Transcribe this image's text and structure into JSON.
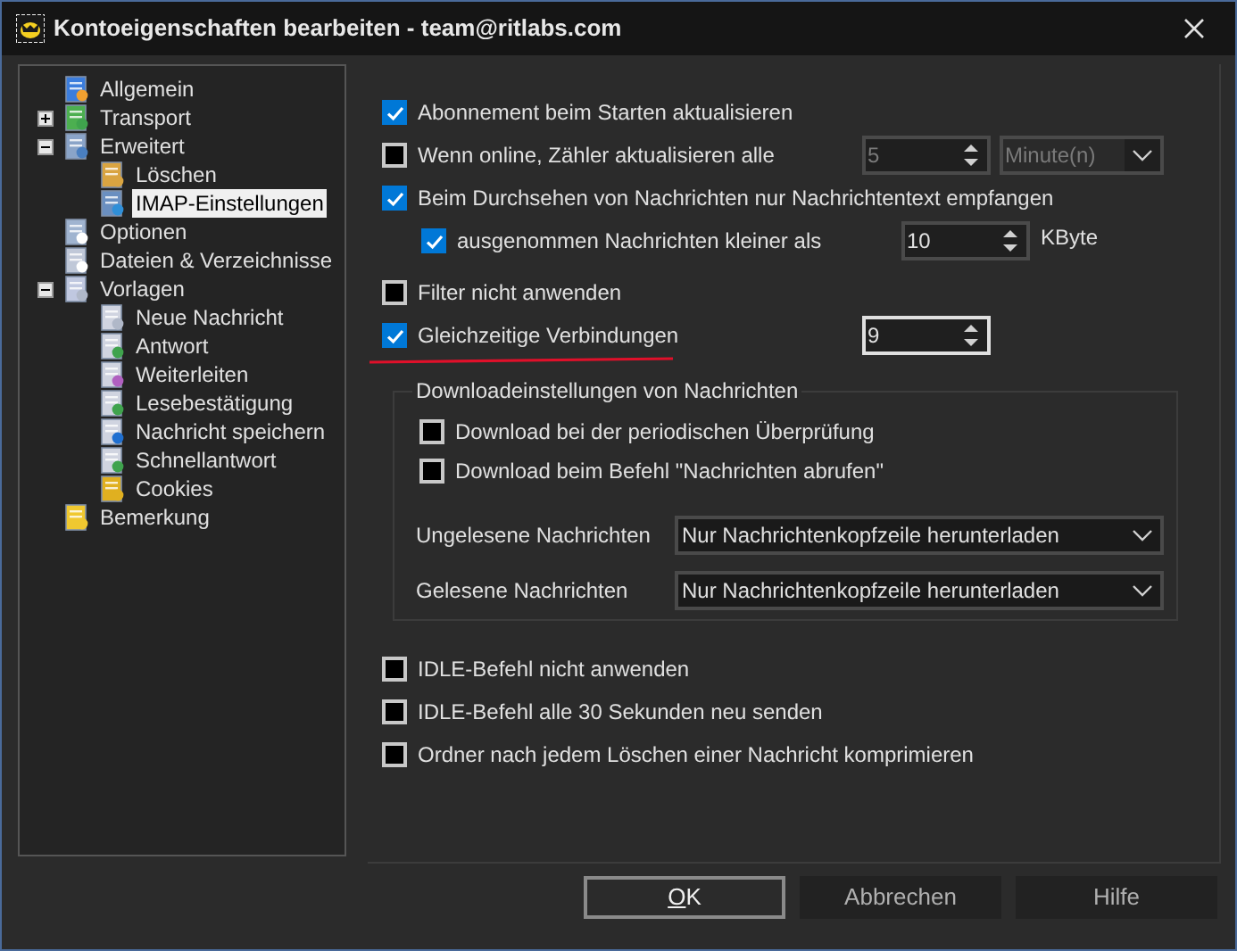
{
  "window": {
    "title": "Kontoeigenschaften bearbeiten - team@ritlabs.com"
  },
  "tree": [
    {
      "label": "Allgemein",
      "selected": false
    },
    {
      "label": "Transport",
      "selected": false,
      "expanded": false
    },
    {
      "label": "Erweitert",
      "selected": false,
      "expanded": true,
      "children": [
        {
          "label": "Löschen",
          "selected": false
        },
        {
          "label": "IMAP-Einstellungen",
          "selected": true
        }
      ]
    },
    {
      "label": "Optionen",
      "selected": false
    },
    {
      "label": "Dateien & Verzeichnisse",
      "selected": false
    },
    {
      "label": "Vorlagen",
      "selected": false,
      "expanded": true,
      "children": [
        {
          "label": "Neue Nachricht",
          "selected": false
        },
        {
          "label": "Antwort",
          "selected": false
        },
        {
          "label": "Weiterleiten",
          "selected": false
        },
        {
          "label": "Lesebestätigung",
          "selected": false
        },
        {
          "label": "Nachricht speichern",
          "selected": false
        },
        {
          "label": "Schnellantwort",
          "selected": false
        },
        {
          "label": "Cookies",
          "selected": false
        }
      ]
    },
    {
      "label": "Bemerkung",
      "selected": false
    }
  ],
  "options_top": [
    {
      "label": "Abonnement beim Starten aktualisieren",
      "checked": true
    },
    {
      "label": "Wenn online, Zähler aktualisieren alle",
      "checked": false,
      "spin": {
        "value": "5",
        "disabled": true
      },
      "select": {
        "value": "Minute(n)",
        "disabled": true
      }
    },
    {
      "label": "Beim Durchsehen von Nachrichten nur Nachrichtentext empfangen",
      "checked": true,
      "children": [
        {
          "label": "ausgenommen Nachrichten kleiner als",
          "checked": true,
          "spin": {
            "value": "10",
            "disabled": false
          },
          "unit": "KByte"
        }
      ]
    },
    {
      "label": "Filter nicht anwenden",
      "checked": false
    },
    {
      "label": "Gleichzeitige Verbindungen",
      "checked": true,
      "spin": {
        "value": "9",
        "disabled": false,
        "focused": true
      },
      "underlined": true
    }
  ],
  "download_group": {
    "title": "Downloadeinstellungen von Nachrichten",
    "checkboxes": [
      {
        "label": "Download bei der periodischen Überprüfung",
        "checked": false
      },
      {
        "label": "Download beim Befehl \"Nachrichten abrufen\"",
        "checked": false
      }
    ],
    "selects": [
      {
        "label": "Ungelesene Nachrichten",
        "value": "Nur Nachrichtenkopfzeile herunterladen"
      },
      {
        "label": "Gelesene Nachrichten",
        "value": "Nur Nachrichtenkopfzeile herunterladen"
      }
    ]
  },
  "options_bottom": [
    {
      "label": "IDLE-Befehl nicht anwenden",
      "checked": false
    },
    {
      "label": "IDLE-Befehl alle 30 Sekunden neu senden",
      "checked": false
    },
    {
      "label": "Ordner nach jedem Löschen einer Nachricht komprimieren",
      "checked": false
    }
  ],
  "buttons": [
    {
      "label": "OK",
      "default": true,
      "accelerator_underlined": true
    },
    {
      "label": "Abbrechen",
      "default": false,
      "accelerator_underlined": false
    },
    {
      "label": "Hilfe",
      "default": false,
      "accelerator_underlined": false
    }
  ]
}
